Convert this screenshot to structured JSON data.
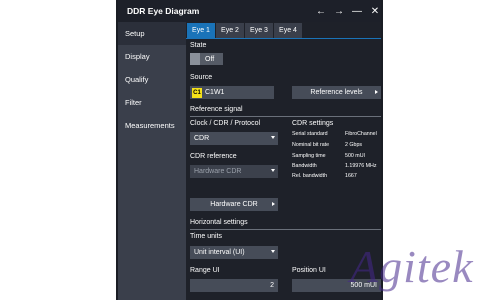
{
  "window": {
    "title": "DDR Eye Diagram",
    "controls": {
      "back": "←",
      "forward": "→",
      "minimize": "—",
      "close": "✕"
    }
  },
  "sidebar": {
    "items": [
      {
        "label": "Setup",
        "active": true
      },
      {
        "label": "Display",
        "active": false
      },
      {
        "label": "Qualify",
        "active": false
      },
      {
        "label": "Filter",
        "active": false
      },
      {
        "label": "Measurements",
        "active": false
      }
    ]
  },
  "tabs": [
    {
      "label": "Eye 1",
      "active": true
    },
    {
      "label": "Eye 2",
      "active": false
    },
    {
      "label": "Eye 3",
      "active": false
    },
    {
      "label": "Eye 4",
      "active": false
    }
  ],
  "state": {
    "label": "State",
    "toggle": "Off"
  },
  "source": {
    "label": "Source",
    "chip": "C1",
    "value": "C1W1",
    "ref_button": "Reference levels"
  },
  "reference_signal": {
    "heading": "Reference signal",
    "clock_label": "Clock / CDR / Protocol",
    "clock_value": "CDR",
    "cdr_ref_label": "CDR reference",
    "cdr_ref_value": "Hardware CDR",
    "hw_cdr_button": "Hardware CDR"
  },
  "cdr_settings": {
    "heading": "CDR settings",
    "rows": [
      {
        "key": "Serial standard",
        "value": "FibroChannel"
      },
      {
        "key": "Nominal bit rate",
        "value": "2 Gbps"
      },
      {
        "key": "Sampling time",
        "value": "500 mUI"
      },
      {
        "key": "Bandwidth",
        "value": "1.19976 MHz"
      },
      {
        "key": "Rel. bandwidth",
        "value": "1667"
      }
    ]
  },
  "horizontal": {
    "heading": "Horizontal settings",
    "time_units_label": "Time units",
    "time_units_value": "Unit interval (UI)",
    "range_label": "Range UI",
    "range_value": "2",
    "position_label": "Position UI",
    "position_value": "500 mUI"
  },
  "watermark": "Agitek",
  "colors": {
    "accent": "#1a73b8",
    "chip": "#f5e11a",
    "panel": "#1e2129",
    "sidebar": "#3a3f4b"
  }
}
